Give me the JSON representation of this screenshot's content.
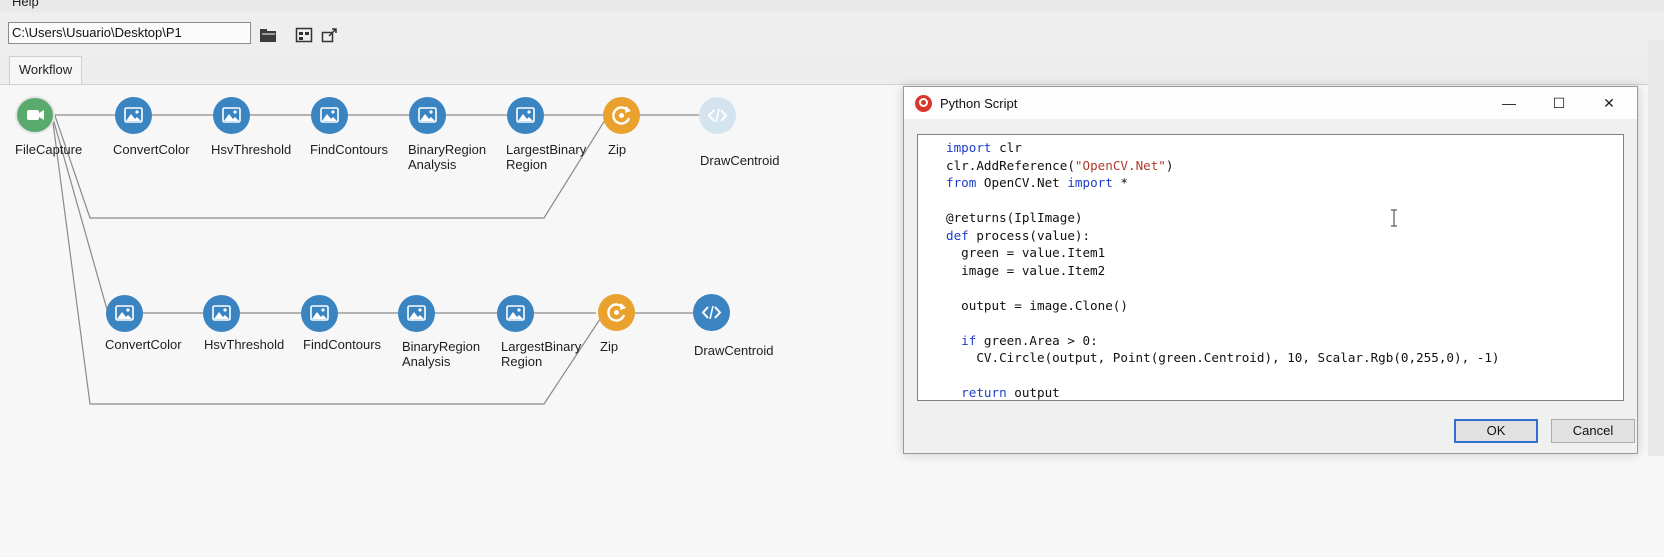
{
  "menu": {
    "help": "Help"
  },
  "toolbar": {
    "path": "C:\\Users\\Usuario\\Desktop\\P1",
    "icons": [
      "open-folder-icon",
      "grid-icon",
      "export-icon"
    ]
  },
  "tabs": {
    "workflow": "Workflow"
  },
  "workflow": {
    "source_label": "FileCapture",
    "row1": {
      "convert": "ConvertColor",
      "hsv": "HsvThreshold",
      "contours": "FindContours",
      "binary_1": "BinaryRegion",
      "binary_2": "Analysis",
      "largest_1": "LargestBinary",
      "largest_2": "Region",
      "zip": "Zip",
      "draw": "DrawCentroid"
    },
    "row2": {
      "convert": "ConvertColor",
      "hsv": "HsvThreshold",
      "contours": "FindContours",
      "binary_1": "BinaryRegion",
      "binary_2": "Analysis",
      "largest_1": "LargestBinary",
      "largest_2": "Region",
      "zip": "Zip",
      "draw": "DrawCentroid"
    }
  },
  "dialog": {
    "title": "Python Script",
    "controls": {
      "minimize": "—",
      "maximize": "☐",
      "close": "✕"
    },
    "code": {
      "l1_kw": "import",
      "l1_rest": " clr",
      "l2_a": "clr.AddReference(",
      "l2_str": "\"OpenCV.Net\"",
      "l2_b": ")",
      "l3_kw": "from",
      "l3_mid": " OpenCV.Net ",
      "l3_kw2": "import",
      "l3_rest": " *",
      "l5": "@returns(IplImage)",
      "l6_kw": "def",
      "l6_rest": " process(value):",
      "l7": "  green = value.Item1",
      "l8": "  image = value.Item2",
      "l10": "  output = image.Clone()",
      "l12_indent": "  ",
      "l12_kw": "if",
      "l12_rest": " green.Area > 0:",
      "l13": "    CV.Circle(output, Point(green.Centroid), 10, Scalar.Rgb(0,255,0), -1)",
      "l15_indent": "  ",
      "l15_kw": "return",
      "l15_rest": " output"
    },
    "ok": "OK",
    "cancel": "Cancel"
  }
}
